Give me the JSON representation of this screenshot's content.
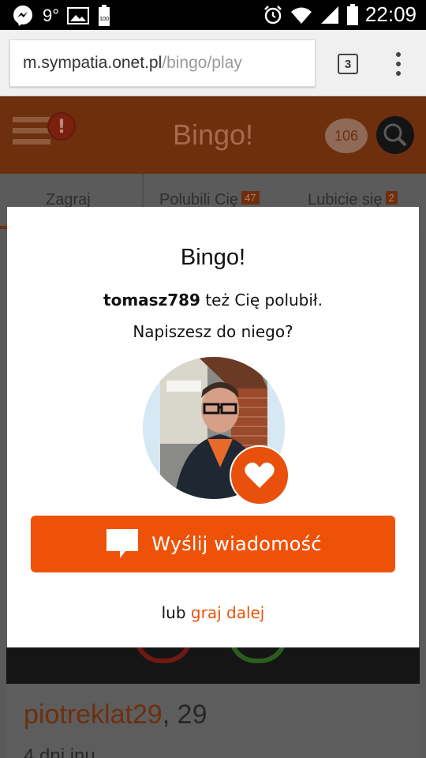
{
  "status_bar": {
    "temperature": "9°",
    "battery_label": "100",
    "time": "22:09",
    "icons": [
      "messenger-icon",
      "image-icon",
      "battery-full-icon",
      "alarm-icon",
      "wifi-icon",
      "signal-icon",
      "battery-icon"
    ]
  },
  "browser": {
    "url_host": "m.sympatia.onet.pl",
    "url_path": "/bingo/play",
    "tab_count": "3"
  },
  "app_header": {
    "title": "Bingo!",
    "notification_badge": "!",
    "messages_count": "106"
  },
  "tabs": [
    {
      "label": "Zagraj"
    },
    {
      "label": "Polubili Cię",
      "count": "47"
    },
    {
      "label": "Lubicie się",
      "count": "2"
    }
  ],
  "background_profile": {
    "nick": "piotreklat29",
    "age": ", 29",
    "sub": "4 dni inu"
  },
  "modal": {
    "title": "Bingo!",
    "username": "tomasz789",
    "liked_text": " też Cię polubił.",
    "question": "Napiszesz do niego?",
    "send_button_label": "Wyślij wiadomość",
    "footer_prefix": "lub ",
    "footer_link": "graj dalej"
  },
  "colors": {
    "accent": "#ee5208",
    "header_dimmed": "#6e2f0e",
    "overlay": "#5a5a5a"
  }
}
